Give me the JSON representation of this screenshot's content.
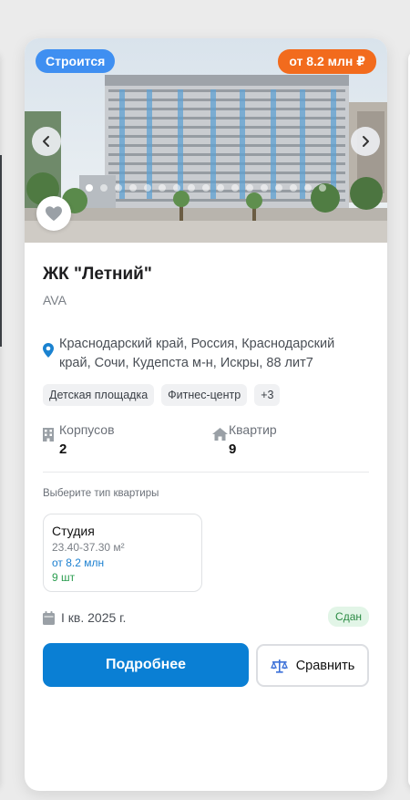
{
  "listing": {
    "status_badge": "Строится",
    "price_badge": "от 8.2 млн ₽",
    "slider": {
      "slide_count": 17,
      "active_index": 0
    },
    "name": "ЖК \"Летний\"",
    "developer": "AVA",
    "address": "Краснодарский край, Россия, Краснодарский край, Сочи, Кудепста м-н, Искры, 88 лит7",
    "tags": [
      "Детская площадка",
      "Фитнес-центр",
      "+3"
    ],
    "stats": {
      "buildings_label": "Корпусов",
      "buildings_value": "2",
      "flats_label": "Квартир",
      "flats_value": "9"
    },
    "choose_label": "Выберите тип квартиры",
    "apartment_type": {
      "name": "Студия",
      "area": "23.40-37.30 м²",
      "price": "от 8.2 млн",
      "count": "9 шт"
    },
    "completion_date": "I кв. 2025 г.",
    "completion_status": "Сдан",
    "details_button": "Подробнее",
    "compare_button": "Сравнить"
  },
  "icons": {
    "prev": "chevron-left-icon",
    "next": "chevron-right-icon",
    "favorite": "heart-icon",
    "location": "map-pin-icon",
    "buildings": "building-icon",
    "flats": "house-icon",
    "date": "calendar-icon",
    "compare": "scales-icon"
  },
  "colors": {
    "status_badge": "#3f8ff1",
    "price_badge": "#f26b1d",
    "primary": "#0a7fd4",
    "success_bg": "#e2f5e7",
    "success_text": "#2a8a43"
  }
}
